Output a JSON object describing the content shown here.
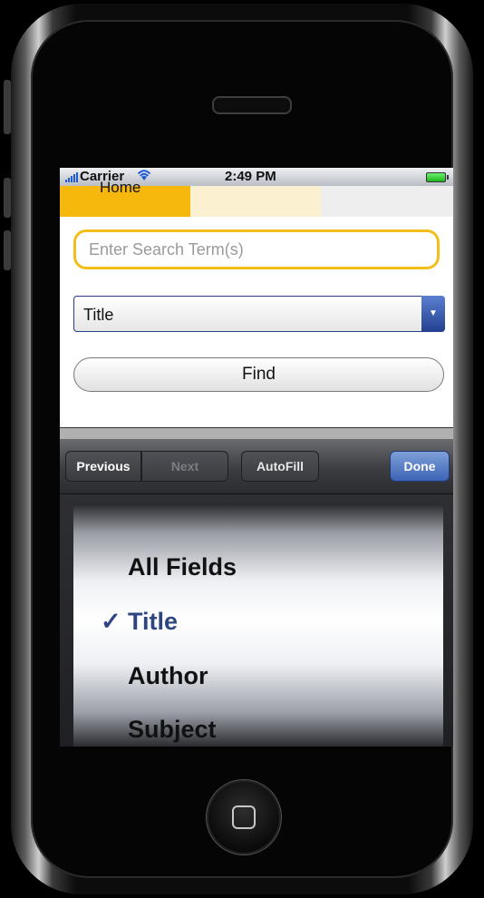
{
  "status_bar": {
    "carrier": "Carrier",
    "time": "2:49 PM",
    "wifi_icon": "wifi-icon",
    "battery_icon": "battery-icon"
  },
  "tabs": {
    "home_label": "Home"
  },
  "search": {
    "placeholder": "Enter Search Term(s)",
    "value": ""
  },
  "select": {
    "value": "Title"
  },
  "find_button": {
    "label": "Find"
  },
  "toolbar": {
    "previous": "Previous",
    "next": "Next",
    "autofill": "AutoFill",
    "done": "Done"
  },
  "picker": {
    "options": [
      "All Fields",
      "Title",
      "Author",
      "Subject"
    ],
    "selected": "Title",
    "check_glyph": "✓"
  },
  "colors": {
    "tab_active": "#f6b80c",
    "input_border": "#f1be1b",
    "done_button": "#3c63b5",
    "selected_text": "#2e4680"
  }
}
